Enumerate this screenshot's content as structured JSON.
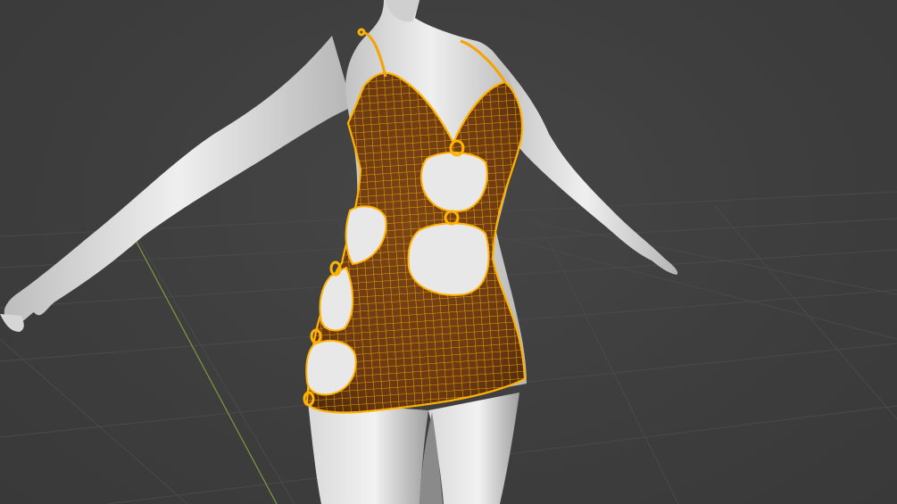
{
  "viewport": {
    "background_color": "#3d3d3d",
    "grid_line_color": "#4a4a4a",
    "y_axis_color": "#7f9c3a"
  },
  "model": {
    "skin_color": "#e6e6e6",
    "skin_shadow_color": "#a9a9a9"
  },
  "garment": {
    "fabric_color": "#6b3a12",
    "wireframe_color": "#f5a300",
    "edge_highlight_color": "#ffb300",
    "rings": 6,
    "cutouts": 5
  }
}
